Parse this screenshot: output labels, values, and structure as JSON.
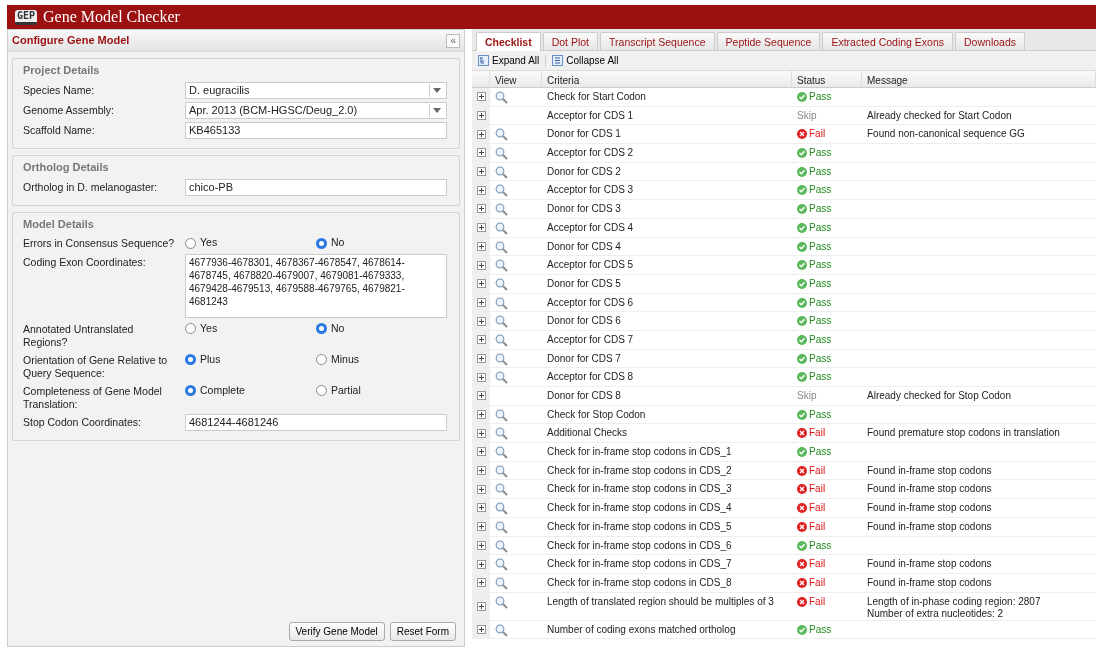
{
  "app": {
    "logo": "GEP",
    "title": "Gene Model Checker"
  },
  "left_panel": {
    "title": "Configure Gene Model",
    "collapse_button": "«",
    "sections": [
      {
        "legend": "Project Details",
        "fields": [
          {
            "kind": "select",
            "label": "Species Name:",
            "value": "D. eugracilis"
          },
          {
            "kind": "select",
            "label": "Genome Assembly:",
            "value": "Apr. 2013 (BCM-HGSC/Deug_2.0)"
          },
          {
            "kind": "text",
            "label": "Scaffold Name:",
            "value": "KB465133"
          }
        ]
      },
      {
        "legend": "Ortholog Details",
        "fields": [
          {
            "kind": "text",
            "label": "Ortholog in D. melanogaster:",
            "value": "chico-PB"
          }
        ]
      },
      {
        "legend": "Model Details",
        "fields": [
          {
            "kind": "radio",
            "label": "Errors in Consensus Sequence?",
            "options": [
              {
                "label": "Yes",
                "selected": false
              },
              {
                "label": "No",
                "selected": true
              }
            ]
          },
          {
            "kind": "textarea",
            "label": "Coding Exon Coordinates:",
            "value": "4677936-4678301, 4678367-4678547, 4678614-4678745, 4678820-4679007, 4679081-4679333, 4679428-4679513, 4679588-4679765, 4679821-4681243"
          },
          {
            "kind": "radio",
            "label": "Annotated Untranslated Regions?",
            "options": [
              {
                "label": "Yes",
                "selected": false
              },
              {
                "label": "No",
                "selected": true
              }
            ]
          },
          {
            "kind": "radio",
            "label": "Orientation of Gene Relative to Query Sequence:",
            "options": [
              {
                "label": "Plus",
                "selected": true
              },
              {
                "label": "Minus",
                "selected": false
              }
            ]
          },
          {
            "kind": "radio",
            "label": "Completeness of Gene Model Translation:",
            "options": [
              {
                "label": "Complete",
                "selected": true
              },
              {
                "label": "Partial",
                "selected": false
              }
            ]
          },
          {
            "kind": "text",
            "label": "Stop Codon Coordinates:",
            "value": "4681244-4681246"
          }
        ]
      }
    ],
    "buttons": [
      "Verify Gene Model",
      "Reset Form"
    ]
  },
  "tabs": [
    {
      "label": "Checklist",
      "selected": true
    },
    {
      "label": "Dot Plot",
      "selected": false
    },
    {
      "label": "Transcript Sequence",
      "selected": false
    },
    {
      "label": "Peptide Sequence",
      "selected": false
    },
    {
      "label": "Extracted Coding Exons",
      "selected": false
    },
    {
      "label": "Downloads",
      "selected": false
    }
  ],
  "toolbar": [
    "Expand All",
    "Collapse All"
  ],
  "table": {
    "columns": [
      "View",
      "Criteria",
      "Status",
      "Message"
    ],
    "rows": [
      {
        "view": true,
        "criteria": "Check for Start Codon",
        "kind": "pass",
        "status": "Pass",
        "message": ""
      },
      {
        "view": false,
        "criteria": "Acceptor for CDS 1",
        "kind": "skip",
        "status": "Skip",
        "message": "Already checked for Start Codon"
      },
      {
        "view": true,
        "criteria": "Donor for CDS 1",
        "kind": "fail",
        "status": "Fail",
        "message": "Found non-canonical sequence GG"
      },
      {
        "view": true,
        "criteria": "Acceptor for CDS 2",
        "kind": "pass",
        "status": "Pass",
        "message": ""
      },
      {
        "view": true,
        "criteria": "Donor for CDS 2",
        "kind": "pass",
        "status": "Pass",
        "message": ""
      },
      {
        "view": true,
        "criteria": "Acceptor for CDS 3",
        "kind": "pass",
        "status": "Pass",
        "message": ""
      },
      {
        "view": true,
        "criteria": "Donor for CDS 3",
        "kind": "pass",
        "status": "Pass",
        "message": ""
      },
      {
        "view": true,
        "criteria": "Acceptor for CDS 4",
        "kind": "pass",
        "status": "Pass",
        "message": ""
      },
      {
        "view": true,
        "criteria": "Donor for CDS 4",
        "kind": "pass",
        "status": "Pass",
        "message": ""
      },
      {
        "view": true,
        "criteria": "Acceptor for CDS 5",
        "kind": "pass",
        "status": "Pass",
        "message": ""
      },
      {
        "view": true,
        "criteria": "Donor for CDS 5",
        "kind": "pass",
        "status": "Pass",
        "message": ""
      },
      {
        "view": true,
        "criteria": "Acceptor for CDS 6",
        "kind": "pass",
        "status": "Pass",
        "message": ""
      },
      {
        "view": true,
        "criteria": "Donor for CDS 6",
        "kind": "pass",
        "status": "Pass",
        "message": ""
      },
      {
        "view": true,
        "criteria": "Acceptor for CDS 7",
        "kind": "pass",
        "status": "Pass",
        "message": ""
      },
      {
        "view": true,
        "criteria": "Donor for CDS 7",
        "kind": "pass",
        "status": "Pass",
        "message": ""
      },
      {
        "view": true,
        "criteria": "Acceptor for CDS 8",
        "kind": "pass",
        "status": "Pass",
        "message": ""
      },
      {
        "view": false,
        "criteria": "Donor for CDS 8",
        "kind": "skip",
        "status": "Skip",
        "message": "Already checked for Stop Codon"
      },
      {
        "view": true,
        "criteria": "Check for Stop Codon",
        "kind": "pass",
        "status": "Pass",
        "message": ""
      },
      {
        "view": true,
        "criteria": "Additional Checks",
        "kind": "fail",
        "status": "Fail",
        "message": "Found premature stop codons in translation"
      },
      {
        "view": true,
        "criteria": "Check for in-frame stop codons in CDS_1",
        "kind": "pass",
        "status": "Pass",
        "message": ""
      },
      {
        "view": true,
        "criteria": "Check for in-frame stop codons in CDS_2",
        "kind": "fail",
        "status": "Fail",
        "message": "Found in-frame stop codons"
      },
      {
        "view": true,
        "criteria": "Check for in-frame stop codons in CDS_3",
        "kind": "fail",
        "status": "Fail",
        "message": "Found in-frame stop codons"
      },
      {
        "view": true,
        "criteria": "Check for in-frame stop codons in CDS_4",
        "kind": "fail",
        "status": "Fail",
        "message": "Found in-frame stop codons"
      },
      {
        "view": true,
        "criteria": "Check for in-frame stop codons in CDS_5",
        "kind": "fail",
        "status": "Fail",
        "message": "Found in-frame stop codons"
      },
      {
        "view": true,
        "criteria": "Check for in-frame stop codons in CDS_6",
        "kind": "pass",
        "status": "Pass",
        "message": ""
      },
      {
        "view": true,
        "criteria": "Check for in-frame stop codons in CDS_7",
        "kind": "fail",
        "status": "Fail",
        "message": "Found in-frame stop codons"
      },
      {
        "view": true,
        "criteria": "Check for in-frame stop codons in CDS_8",
        "kind": "fail",
        "status": "Fail",
        "message": "Found in-frame stop codons"
      },
      {
        "view": true,
        "criteria": "Length of translated region should be multiples of 3",
        "kind": "fail",
        "status": "Fail",
        "message": "Length of in-phase coding region: 2807\nNumber of extra nucleotides: 2"
      },
      {
        "view": true,
        "criteria": "Number of coding exons matched ortholog",
        "kind": "pass",
        "status": "Pass",
        "message": ""
      }
    ]
  }
}
